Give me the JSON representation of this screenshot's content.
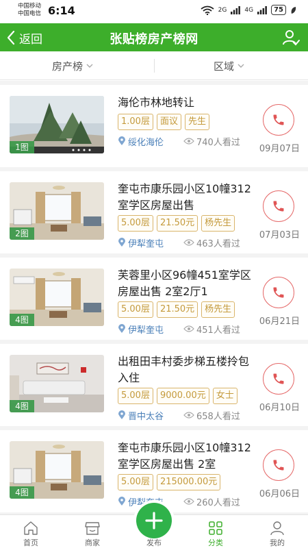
{
  "status_bar": {
    "carrier_1": "中国移动",
    "carrier_2": "中国电信",
    "time": "6:14",
    "network_1": "2G",
    "network_2": "4G",
    "battery": "75"
  },
  "header": {
    "back_label": "返回",
    "title": "张贴榜房产榜网"
  },
  "filters": {
    "category": "房产榜",
    "region": "区域"
  },
  "listings": [
    {
      "title": "海伦市林地转让",
      "tags": [
        "1.00层",
        "面议",
        "先生"
      ],
      "location": "绥化海伦",
      "views": "740人看过",
      "date": "09月07日",
      "photo_count": "1图"
    },
    {
      "title": "奎屯市康乐园小区10幢312室学区房屋出售",
      "tags": [
        "5.00层",
        "21.50元",
        "杨先生"
      ],
      "location": "伊犁奎屯",
      "views": "463人看过",
      "date": "07月03日",
      "photo_count": "2图"
    },
    {
      "title": "芙蓉里小区96幢451室学区房屋出售 2室2厅1",
      "tags": [
        "5.00层",
        "21.50元",
        "杨先生"
      ],
      "location": "伊犁奎屯",
      "views": "451人看过",
      "date": "06月21日",
      "photo_count": "4图"
    },
    {
      "title": "出租田丰村委步梯五楼拎包入住",
      "tags": [
        "5.00层",
        "9000.00元",
        "女士"
      ],
      "location": "晋中太谷",
      "views": "658人看过",
      "date": "06月10日",
      "photo_count": "4图"
    },
    {
      "title": "奎屯市康乐园小区10幢312室学区房屋出售 2室",
      "tags": [
        "5.00层",
        "215000.00元"
      ],
      "location": "伊犁奎屯",
      "views": "260人看过",
      "date": "06月06日",
      "photo_count": "4图"
    }
  ],
  "tab_bar": {
    "home": "首页",
    "merchants": "商家",
    "publish": "发布",
    "categories": "分类",
    "mine": "我的"
  },
  "colors": {
    "brand_green": "#3dae2b",
    "tag_gold": "#c49a3c",
    "call_red": "#e56b6b",
    "location_blue": "#4a7fb8"
  }
}
